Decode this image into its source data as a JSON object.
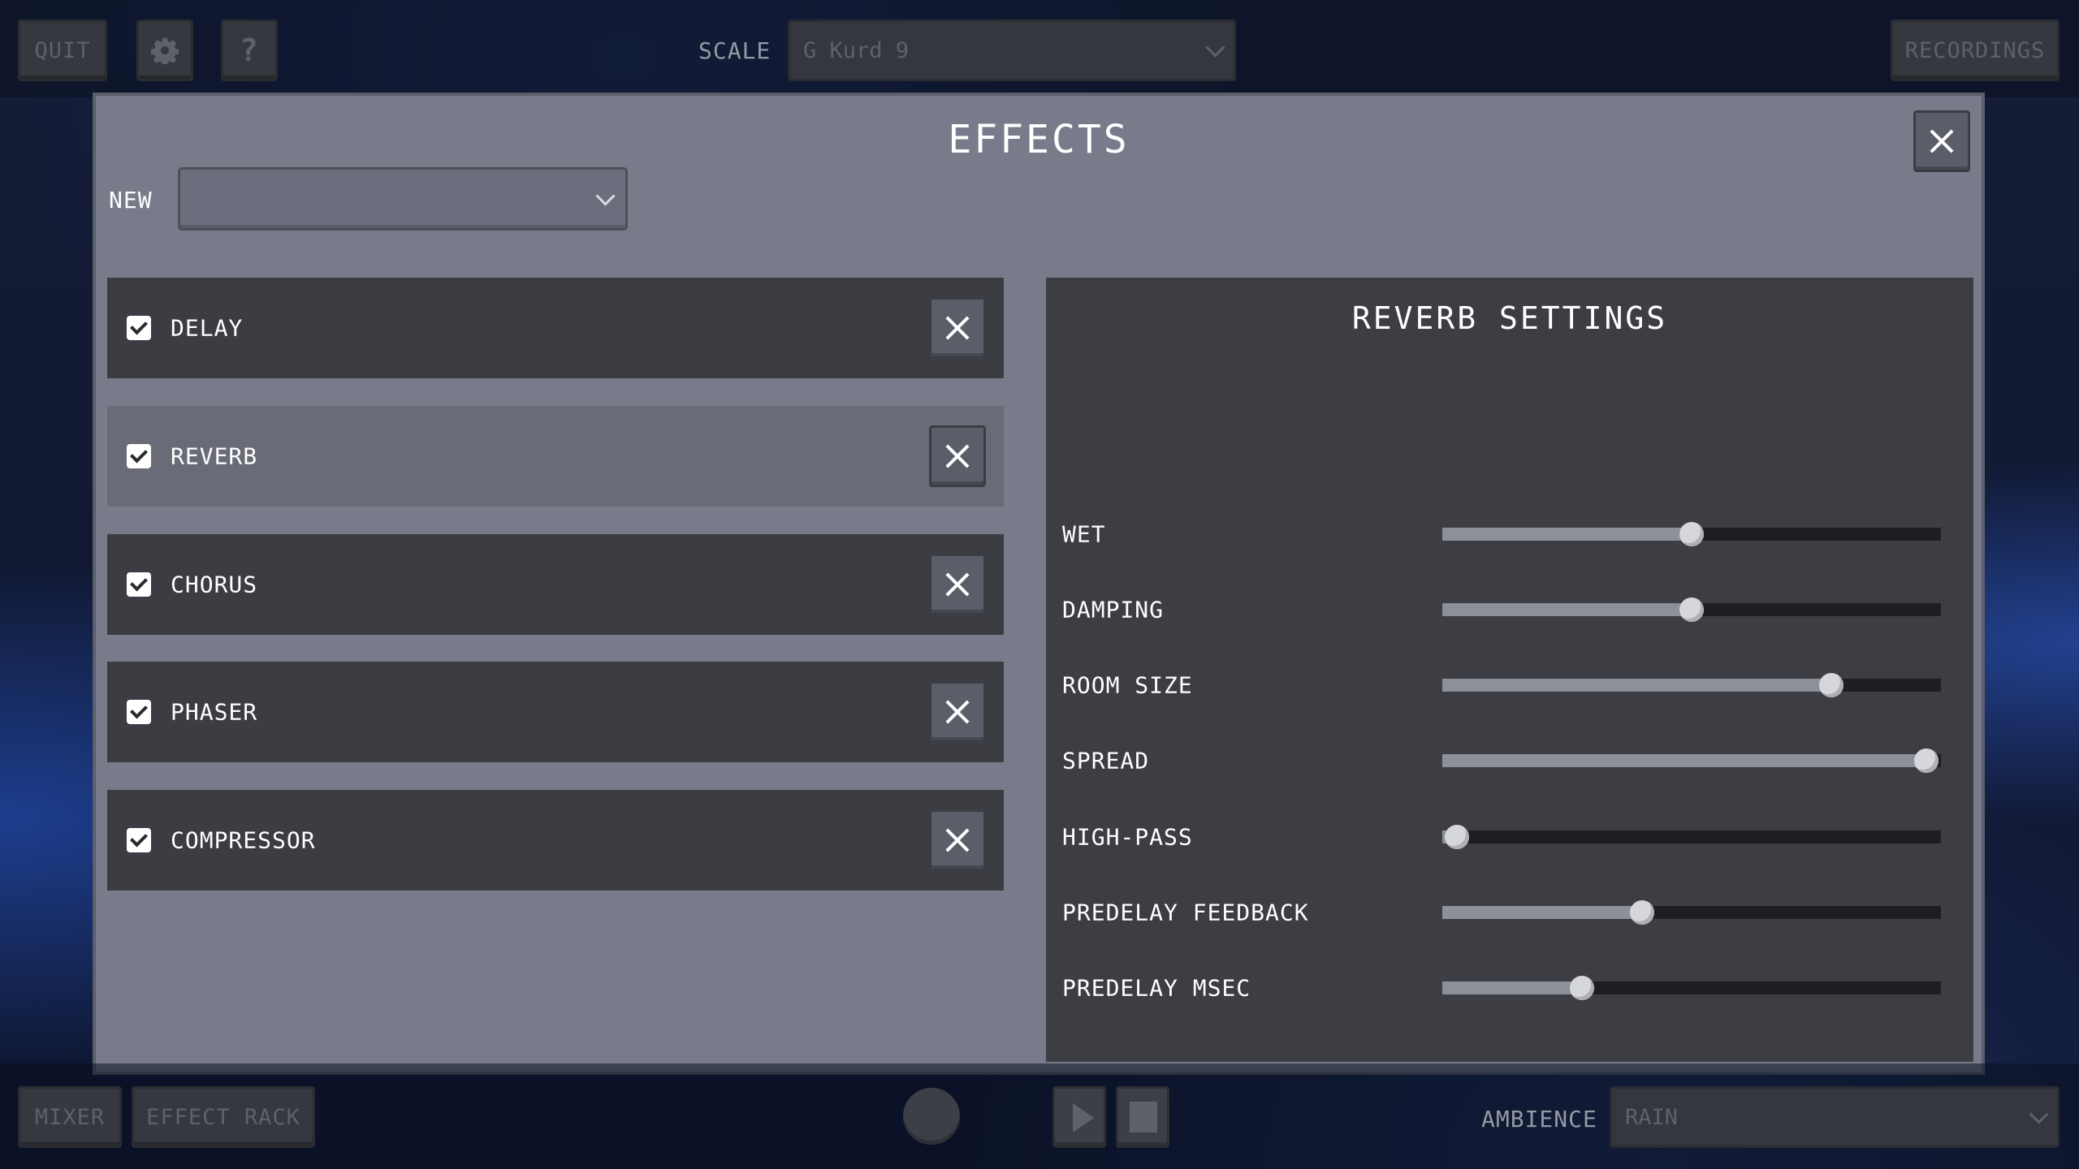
{
  "topbar": {
    "quit_label": "QUIT",
    "scale_label": "SCALE",
    "scale_value": "G Kurd 9",
    "recordings_label": "RECORDINGS",
    "help_label": "?"
  },
  "modal": {
    "title": "EFFECTS",
    "new_label": "NEW",
    "new_value": ""
  },
  "effects": [
    {
      "name": "DELAY",
      "checked": true,
      "selected": false
    },
    {
      "name": "REVERB",
      "checked": true,
      "selected": true
    },
    {
      "name": "CHORUS",
      "checked": true,
      "selected": false
    },
    {
      "name": "PHASER",
      "checked": true,
      "selected": false
    },
    {
      "name": "COMPRESSOR",
      "checked": true,
      "selected": false
    }
  ],
  "settings": {
    "title": "REVERB SETTINGS",
    "params": [
      {
        "label": "WET",
        "value": 0.5
      },
      {
        "label": "DAMPING",
        "value": 0.5
      },
      {
        "label": "ROOM SIZE",
        "value": 0.78
      },
      {
        "label": "SPREAD",
        "value": 0.97
      },
      {
        "label": "HIGH-PASS",
        "value": 0.03
      },
      {
        "label": "PREDELAY FEEDBACK",
        "value": 0.4
      },
      {
        "label": "PREDELAY MSEC",
        "value": 0.28
      }
    ]
  },
  "bottombar": {
    "mixer_label": "MIXER",
    "effect_rack_label": "EFFECT RACK",
    "ambience_label": "AMBIENCE",
    "ambience_value": "RAIN"
  },
  "colors": {
    "modal_bg": "#787b8a",
    "row_bg": "#3c3d42",
    "row_selected_bg": "#696b76",
    "panel_bg": "#3d3e43"
  }
}
